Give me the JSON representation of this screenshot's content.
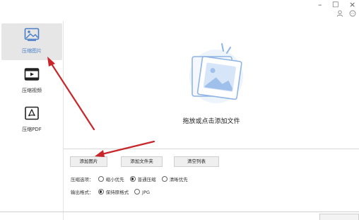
{
  "window": {
    "minimize": "–",
    "maximize": "□",
    "close": "×"
  },
  "sidebar": {
    "items": [
      {
        "label": "压缩图片",
        "active": true
      },
      {
        "label": "压缩视频",
        "active": false
      },
      {
        "label": "压缩PDF",
        "active": false
      }
    ]
  },
  "drop_area": {
    "text": "拖放或点击添加文件"
  },
  "toolbar": {
    "add_image": "添加图片",
    "add_folder": "添加文件夹",
    "clear_list": "清空列表"
  },
  "compress_options": {
    "label": "压缩选项：",
    "options": [
      {
        "label": "缩小优先",
        "selected": false
      },
      {
        "label": "普通压缩",
        "selected": true
      },
      {
        "label": "清晰优先",
        "selected": false
      }
    ]
  },
  "output_format": {
    "label": "输出格式：",
    "options": [
      {
        "label": "保持原格式",
        "selected": true
      },
      {
        "label": "JPG",
        "selected": false
      }
    ]
  },
  "colors": {
    "accent": "#4a7ec8",
    "annotation_arrow": "#c8262a"
  }
}
